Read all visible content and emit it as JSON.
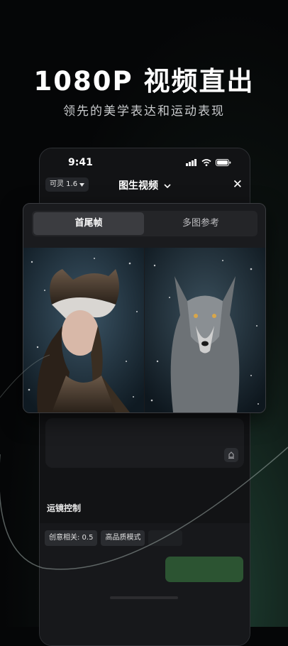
{
  "headline": "1080P 视频直出",
  "subline": "领先的美学表达和运动表现",
  "status_bar": {
    "time": "9:41"
  },
  "app_bar": {
    "model_label": "可灵 1.6",
    "title": "图生视频",
    "close_label": "✕"
  },
  "tabs": [
    {
      "label": "首尾帧",
      "active": true
    },
    {
      "label": "多图参考",
      "active": false
    }
  ],
  "camera_control_label": "运镜控制",
  "settings": {
    "creativity": "创意相关: 0.5",
    "mode": "高品质模式"
  },
  "colors": {
    "accent": "#5bd464",
    "background": "#050607"
  }
}
